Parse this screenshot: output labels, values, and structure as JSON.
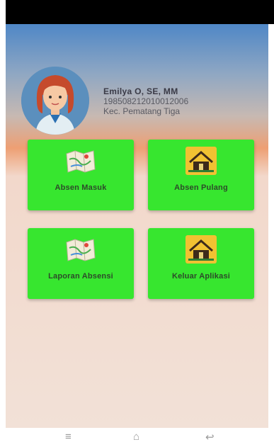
{
  "profile": {
    "name": "Emilya O, SE, MM",
    "nip": "198508212010012006",
    "location": "Kec. Pematang Tiga"
  },
  "menu": [
    {
      "label": "Absen Masuk",
      "icon": "map-icon"
    },
    {
      "label": "Absen Pulang",
      "icon": "house-icon"
    },
    {
      "label": "Laporan Absensi",
      "icon": "map-icon"
    },
    {
      "label": "Keluar Aplikasi",
      "icon": "house-icon"
    }
  ],
  "nav": {
    "menu_glyph": "≡",
    "home_glyph": "⌂",
    "back_glyph": "↩"
  },
  "colors": {
    "tile": "#37e62f",
    "header_blue": "#4f87c6",
    "header_orange": "#ee9f73",
    "background": "#f2e1d7"
  }
}
